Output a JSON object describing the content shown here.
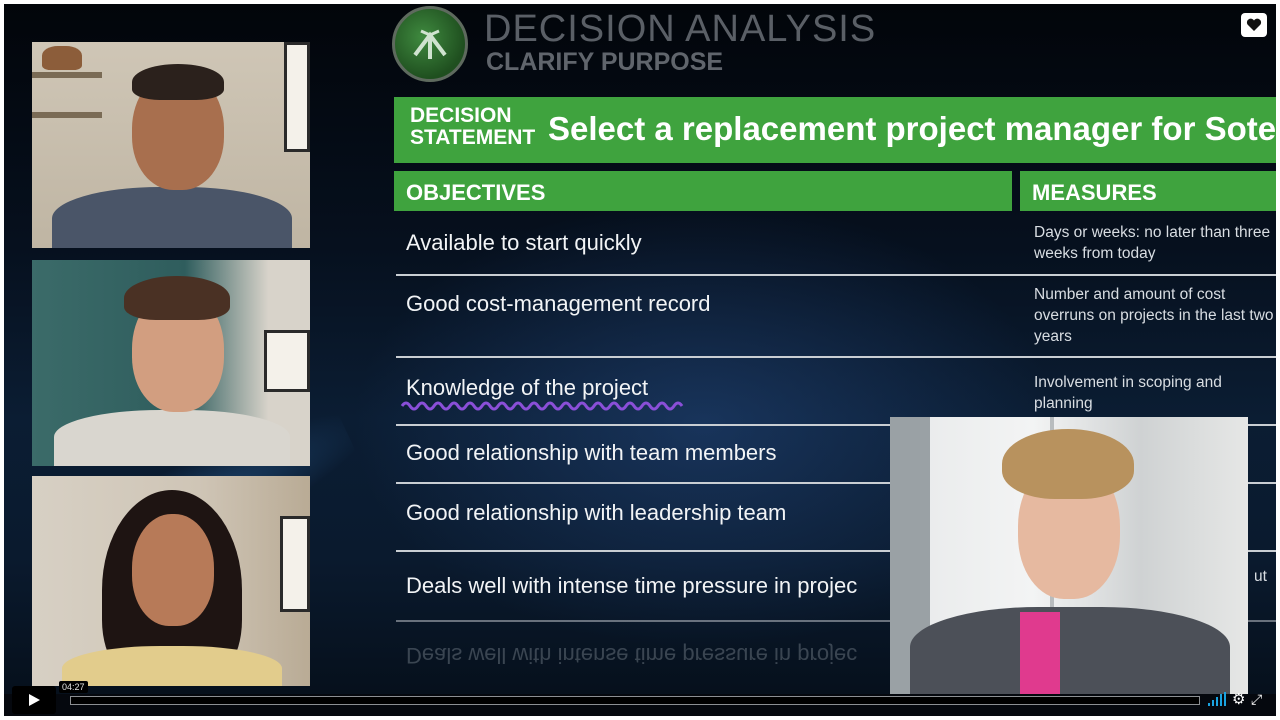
{
  "slide": {
    "title": "DECISION ANALYSIS",
    "subtitle": "CLARIFY PURPOSE",
    "decision_label": "DECISION STATEMENT",
    "decision_text": "Select a replacement project manager for Sote",
    "objectives_header": "OBJECTIVES",
    "measures_header": "MEASURES",
    "objectives": [
      "Available to start quickly",
      "Good cost-management record",
      "Knowledge of the project",
      "Good relationship with team members",
      "Good relationship with leadership team",
      "Deals well with intense time pressure in projec"
    ],
    "measures": [
      "Days or weeks: no later than three weeks from today",
      "Number and amount of cost overruns on projects in the last two years",
      "Involvement in scoping and planning",
      "ut"
    ],
    "reflection_text": "Deals well with intense time pressure in projec"
  },
  "player": {
    "time_badge": "04:27",
    "progress": 0.0,
    "icons": {
      "like": "heart-icon",
      "play": "play-icon",
      "volume": "volume-icon",
      "settings": "gear-icon",
      "fullscreen": "fullscreen-icon",
      "logo": "decision-logo-icon"
    }
  },
  "colors": {
    "accent_green": "#3fa33e",
    "underline": "#8a4fd8",
    "volume_blue": "#1aa3e0"
  }
}
